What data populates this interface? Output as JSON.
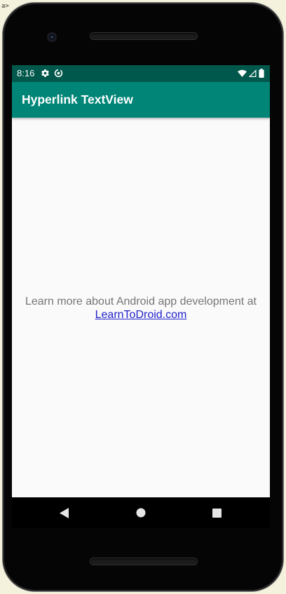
{
  "corner": {
    "text": "a>"
  },
  "status_bar": {
    "time": "8:16",
    "left_icons": [
      "settings-gear-icon",
      "data-saver-icon"
    ],
    "right_icons": [
      "wifi-icon",
      "cell-signal-icon",
      "battery-icon"
    ],
    "color": "#00574b"
  },
  "app_bar": {
    "title": "Hyperlink TextView",
    "color": "#008577"
  },
  "main": {
    "message": "Learn more about Android app development at",
    "link_text": "LearnToDroid.com",
    "link_color": "#2222cc"
  },
  "nav_bar": {
    "buttons": [
      "back-triangle-icon",
      "home-circle-icon",
      "recents-square-icon"
    ]
  }
}
